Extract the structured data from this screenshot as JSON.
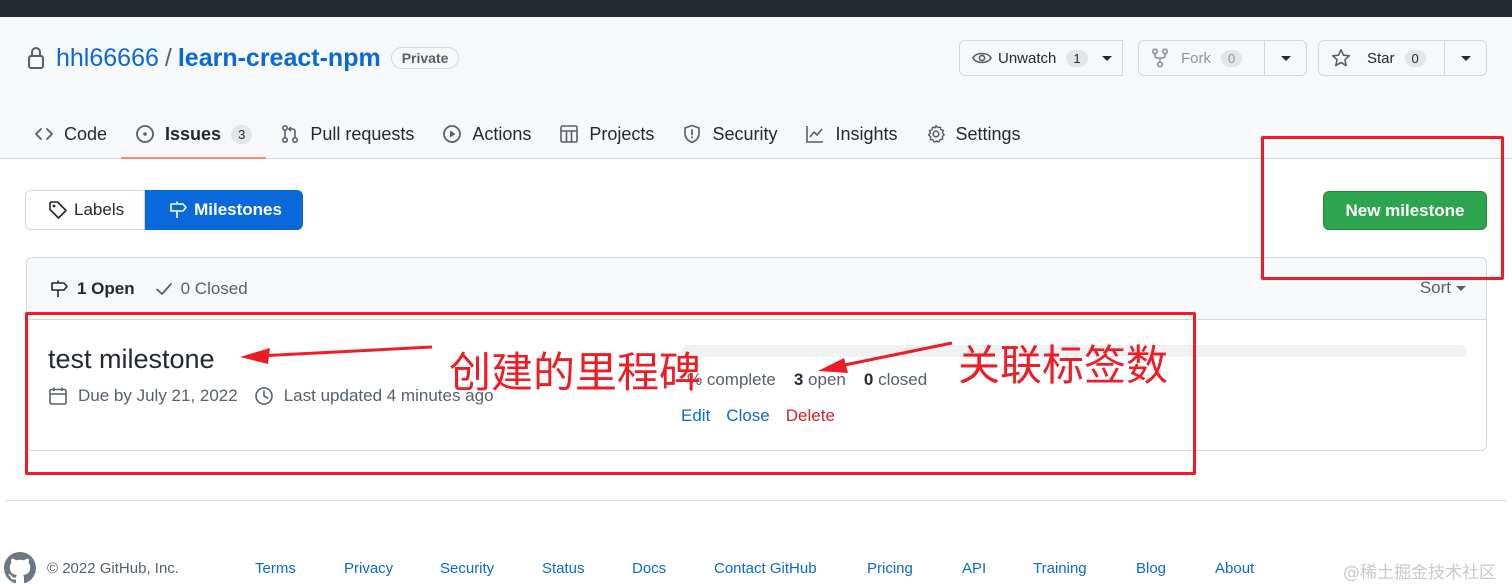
{
  "repo": {
    "owner": "hhl66666",
    "separator": "/",
    "name": "learn-creact-npm",
    "visibility": "Private"
  },
  "repo_actions": {
    "watch": {
      "label": "Unwatch",
      "count": "1"
    },
    "fork": {
      "label": "Fork",
      "count": "0"
    },
    "star": {
      "label": "Star",
      "count": "0"
    }
  },
  "tabs": [
    {
      "label": "Code",
      "icon": "code-icon"
    },
    {
      "label": "Issues",
      "icon": "issue-opened-icon",
      "count": "3",
      "selected": true
    },
    {
      "label": "Pull requests",
      "icon": "git-pull-request-icon"
    },
    {
      "label": "Actions",
      "icon": "play-icon"
    },
    {
      "label": "Projects",
      "icon": "table-icon"
    },
    {
      "label": "Security",
      "icon": "shield-icon"
    },
    {
      "label": "Insights",
      "icon": "graph-icon"
    },
    {
      "label": "Settings",
      "icon": "gear-icon"
    }
  ],
  "subnav": {
    "labels": "Labels",
    "milestones": "Milestones"
  },
  "new_milestone": "New milestone",
  "list": {
    "open_label": "1 Open",
    "closed_label": "0 Closed",
    "sort_label": "Sort"
  },
  "milestone": {
    "title": "test milestone",
    "due": "Due by July 21, 2022",
    "updated": "Last updated 4 minutes ago",
    "progress_percent": 0,
    "complete_label": "% complete",
    "open_count": "3",
    "open_label": "open",
    "closed_count": "0",
    "closed_label": "closed",
    "actions": {
      "edit": "Edit",
      "close": "Close",
      "delete": "Delete"
    }
  },
  "footer": {
    "copyright": "© 2022 GitHub, Inc.",
    "links": [
      "Terms",
      "Privacy",
      "Security",
      "Status",
      "Docs",
      "Contact GitHub",
      "Pricing",
      "API",
      "Training",
      "Blog",
      "About"
    ]
  },
  "annotations": {
    "created_milestone": "创建的里程碑",
    "linked_labels": "关联标签数",
    "color": "#ee1c25"
  },
  "watermark": "@稀土掘金技术社区",
  "colors": {
    "accent": "#0969da",
    "primary_button": "#2da44e",
    "danger": "#cf222e",
    "tab_underline": "#fd8c73"
  }
}
